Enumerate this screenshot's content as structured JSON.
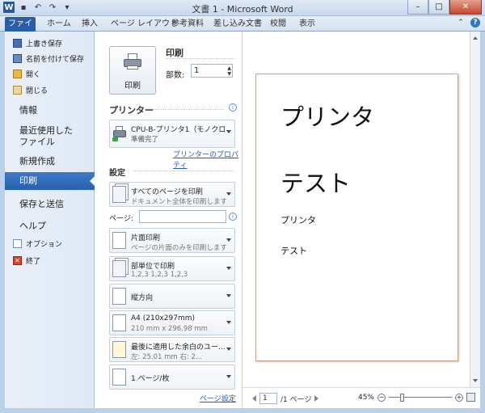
{
  "window": {
    "title": "文書 1 - Microsoft Word",
    "app_letter": "W"
  },
  "tabs": [
    "ファイル",
    "ホーム",
    "挿入",
    "ページ レイアウト",
    "参考資料",
    "差し込み文書",
    "校閲",
    "表示"
  ],
  "backstage": {
    "commands": [
      {
        "label": "上書き保存",
        "icon": "save-icon"
      },
      {
        "label": "名前を付けて保存",
        "icon": "save-as-icon"
      },
      {
        "label": "開く",
        "icon": "open-folder-icon"
      },
      {
        "label": "閉じる",
        "icon": "close-document-icon"
      }
    ],
    "nav": [
      "情報",
      "最近使用した",
      "ファイル",
      "新規作成",
      "印刷",
      "保存と送信",
      "ヘルプ"
    ],
    "bottom_commands": [
      {
        "label": "オプション",
        "icon": "options-icon"
      },
      {
        "label": "終了",
        "icon": "exit-icon"
      }
    ]
  },
  "print": {
    "button_label": "印刷",
    "heading": "印刷",
    "copies_label": "部数:",
    "copies_value": "1",
    "printer_heading": "プリンター",
    "printer_name": "CPU-B-プリンタ1（モノクロ...",
    "printer_status": "準備完了",
    "printer_properties_link": "プリンターのプロパティ",
    "settings_heading": "設定",
    "pages_label": "ページ:",
    "settings": [
      {
        "t1": "すべてのページを印刷",
        "t2": "ドキュメント全体を印刷します"
      },
      {
        "t1": "片面印刷",
        "t2": "ページの片面のみを印刷します"
      },
      {
        "t1": "部単位で印刷",
        "t2": "1,2,3    1,2,3    1,2,3"
      },
      {
        "t1": "縦方向",
        "t2": ""
      },
      {
        "t1": "A4 (210x297mm)",
        "t2": "210 mm x 296.98 mm"
      },
      {
        "t1": "最後に適用した余白のユー...",
        "t2": "左: 25.01 mm   右: 2..."
      },
      {
        "t1": "1 ページ/枚",
        "t2": ""
      }
    ],
    "page_setup_link": "ページ設定"
  },
  "preview": {
    "lines_big": [
      "プリンタ",
      "テスト"
    ],
    "lines_small": [
      "プリンタ",
      "テスト"
    ],
    "page_current": "1",
    "page_total": "/1 ページ",
    "zoom_label": "45%",
    "zoom_level_percent": 45
  }
}
